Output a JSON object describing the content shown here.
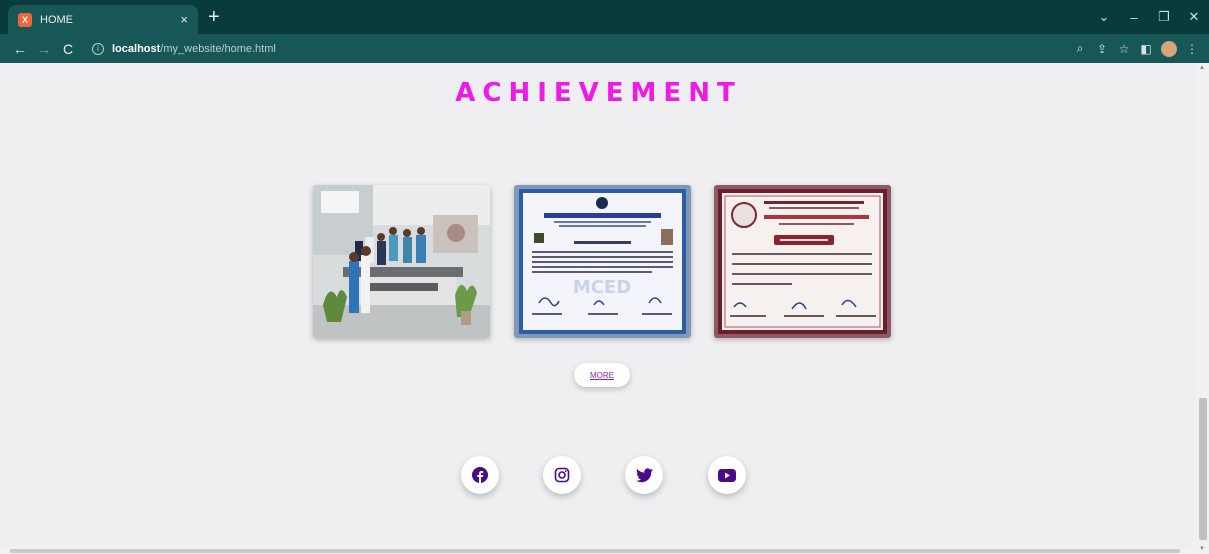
{
  "browser": {
    "tab_title": "HOME",
    "tab_favicon_glyph": "X",
    "new_tab_label": "+",
    "tab_close_label": "×",
    "url_host": "localhost",
    "url_path": "/my_website/home.html",
    "window_controls": {
      "dropdown": "⌄",
      "minimize": "–",
      "restore": "❐",
      "close": "✕"
    },
    "nav": {
      "back": "←",
      "forward": "→",
      "reload": "C"
    },
    "toolbar_icons": {
      "zoom": "⌕",
      "share": "⇪",
      "bookmark": "☆",
      "sidepanel": "◧",
      "menu": "⋮"
    }
  },
  "section": {
    "heading": "ACHIEVEMENT",
    "more_label": "MORE"
  },
  "photos": [
    {
      "icon": "group-photo-image"
    },
    {
      "icon": "certificate-image",
      "org": "MAHARASHTRA CENTRE FOR ENTREPRENEURSHIP DEVELOPMENT",
      "watermark": "MCED"
    },
    {
      "icon": "certificate-image",
      "event": "TECHNOVISION 2022",
      "heading": "CERTIFICATE"
    }
  ],
  "social": [
    {
      "name": "facebook",
      "icon": "facebook-icon"
    },
    {
      "name": "instagram",
      "icon": "instagram-icon"
    },
    {
      "name": "twitter",
      "icon": "twitter-icon"
    },
    {
      "name": "youtube",
      "icon": "youtube-icon"
    }
  ],
  "colors": {
    "heading": "#ee1ae8",
    "chrome_dark": "#0a3b3c",
    "chrome_mid": "#175758",
    "page_bg": "#efeff1",
    "social_icon": "#4a0a8a",
    "more_text": "#8a2ab4"
  }
}
